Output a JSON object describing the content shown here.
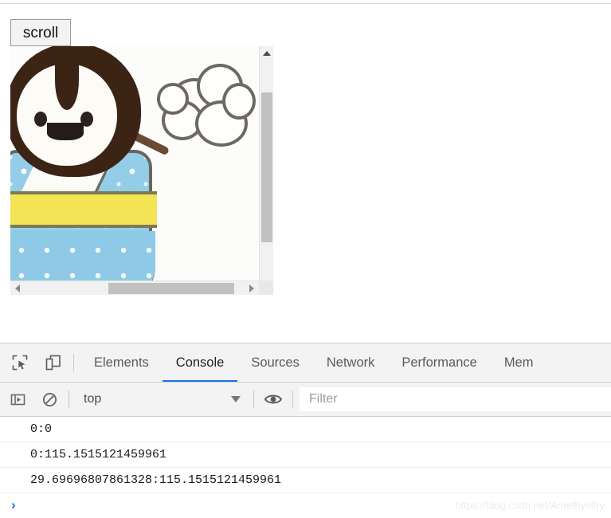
{
  "page": {
    "scroll_button_label": "scroll",
    "illustration_alt": "penguin-in-kimono-illustration",
    "scrollbar": {
      "vertical_up_icon": "triangle-up-icon",
      "vertical_down_icon": "triangle-down-icon",
      "horizontal_left_icon": "triangle-left-icon",
      "horizontal_right_icon": "triangle-right-icon"
    }
  },
  "devtools": {
    "inspect_icon": "inspect-element-icon",
    "device_toolbar_icon": "device-toolbar-icon",
    "tabs": [
      {
        "label": "Elements",
        "active": false
      },
      {
        "label": "Console",
        "active": true
      },
      {
        "label": "Sources",
        "active": false
      },
      {
        "label": "Network",
        "active": false
      },
      {
        "label": "Performance",
        "active": false
      },
      {
        "label": "Mem",
        "active": false
      }
    ],
    "active_tab_accent": "#1a73e8",
    "toolbar": {
      "sidebar_toggle_icon": "console-sidebar-toggle-icon",
      "clear_console_icon": "clear-console-icon",
      "context_value": "top",
      "context_chevron_icon": "chevron-down-icon",
      "live_expression_icon": "eye-icon",
      "filter_placeholder": "Filter",
      "filter_value": ""
    },
    "console": {
      "messages": [
        "0:0",
        "0:115.1515121459961",
        "29.69696807861328:115.1515121459961"
      ],
      "prompt_symbol": "›",
      "prompt_value": ""
    },
    "watermark": "https://blog.csdn.net/Amethystlry"
  }
}
